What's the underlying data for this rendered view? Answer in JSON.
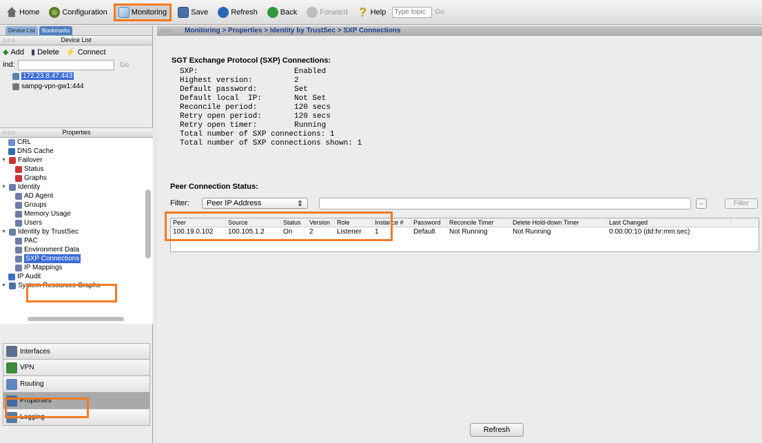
{
  "toolbar": {
    "home": "Home",
    "configuration": "Configuration",
    "monitoring": "Monitoring",
    "save": "Save",
    "refresh": "Refresh",
    "back": "Back",
    "forward": "Forward",
    "help": "Help",
    "help_placeholder": "Type topic",
    "go": "Go"
  },
  "device_list": {
    "tabs": [
      "Device List",
      "Bookmarks"
    ],
    "window_title": "Device List",
    "actions": {
      "add": "Add",
      "delete": "Delete",
      "connect": "Connect"
    },
    "find_label": "ind:",
    "find_go": "Go",
    "devices": [
      "172.23.8.47:443",
      "sampg-vpn-gw1:444"
    ]
  },
  "properties": {
    "window_title": "Properties",
    "tree": [
      "CRL",
      "DNS Cache",
      "Failover",
      "Status",
      "Graphs",
      "Identity",
      "AD Agent",
      "Groups",
      "Memory Usage",
      "Users",
      "Identity by TrustSec",
      "PAC",
      "Environment Data",
      "SXP Connections",
      "IP Mappings",
      "IP Audit",
      "System Resources Graphs"
    ]
  },
  "nav": [
    "Interfaces",
    "VPN",
    "Routing",
    "Properties",
    "Logging"
  ],
  "breadcrumb": "Monitoring > Properties > Identity by TrustSec > SXP Connections",
  "sxp": {
    "title": "SGT Exchange Protocol (SXP) Connections:",
    "fields": [
      {
        "key": "SXP:",
        "value": "Enabled"
      },
      {
        "key": "Highest version:",
        "value": "2"
      },
      {
        "key": "Default password:",
        "value": "Set"
      },
      {
        "key": "Default local  IP:",
        "value": "Not Set"
      },
      {
        "key": "Reconcile period:",
        "value": "120 secs"
      },
      {
        "key": "Retry open period:",
        "value": "120 secs"
      },
      {
        "key": "Retry open timer:",
        "value": "Running"
      }
    ],
    "total_connections": "Total number of SXP connections: 1",
    "total_shown": "Total number of SXP connections shown: 1"
  },
  "peer_status": {
    "title": "Peer Connection Status:",
    "filter_label": "Filter:",
    "filter_select": "Peer IP Address",
    "filter_button": "Filter",
    "columns": [
      "Peer",
      "Source",
      "Status",
      "Version",
      "Role",
      "Instance #",
      "Password",
      "Reconcile Timer",
      "Delete Hold-down Timer",
      "Last Changed"
    ],
    "rows": [
      [
        "100.19.0.102",
        "100.105.1.2",
        "On",
        "2",
        "Listener",
        "1",
        "Default",
        "Not Running",
        "Not Running",
        "0:00:00:10 (dd:hr:mm:sec)"
      ]
    ]
  },
  "refresh_button": "Refresh",
  "colors": {
    "highlight": "#f47a20",
    "selection": "#3b6bd6",
    "link": "#1a3d8f"
  }
}
